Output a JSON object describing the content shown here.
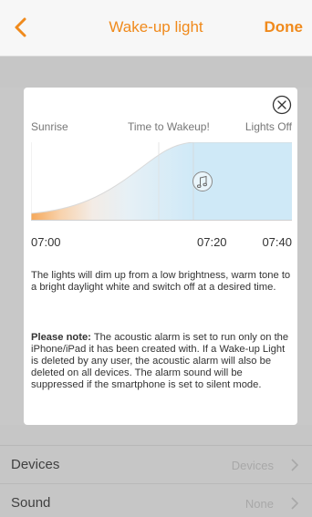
{
  "nav": {
    "title": "Wake-up light",
    "done_label": "Done",
    "back_icon": "chevron-left-icon",
    "accent_color": "#f08a1c"
  },
  "card": {
    "close_icon": "close-circle-icon",
    "phase_labels": {
      "sunrise": "Sunrise",
      "wakeup": "Time to Wakeup!",
      "off": "Lights Off"
    },
    "music_icon": "music-note-icon",
    "times": {
      "start": "07:00",
      "wakeup": "07:20",
      "end": "07:40"
    },
    "description": "The lights will dim up from a low brightness, warm tone to a bright daylight white and switch off at a desired time.",
    "note_heading": "Please note:",
    "note_body": " The acoustic alarm is set to run only on the iPhone/iPad it has been created with. If a Wake-up Light is deleted by any user, the acoustic alarm will also be deleted on all devices. The alarm sound will be suppressed if the smartphone is set to silent mode."
  },
  "rows": [
    {
      "label": "Devices",
      "value": "Devices"
    },
    {
      "label": "Sound",
      "value": "None"
    }
  ]
}
